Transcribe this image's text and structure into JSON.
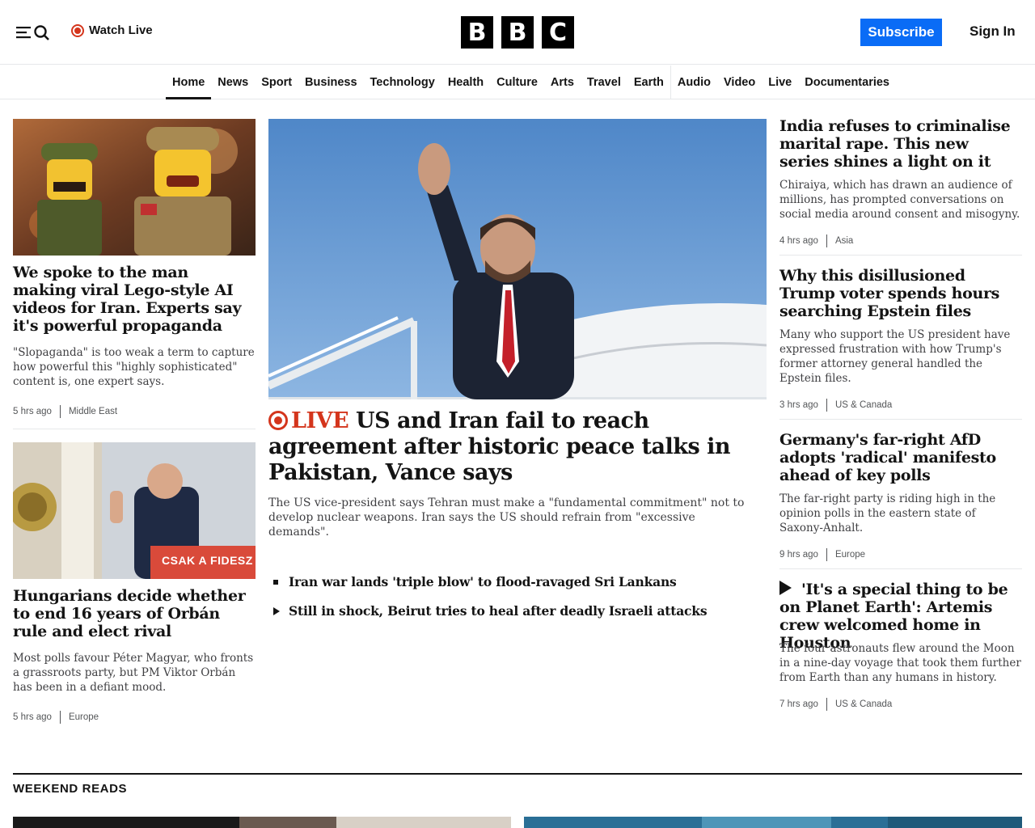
{
  "header": {
    "watch_live": "Watch Live",
    "logo_letters": [
      "B",
      "B",
      "C"
    ],
    "subscribe": "Subscribe",
    "sign_in": "Sign In"
  },
  "nav": {
    "items": [
      "Home",
      "News",
      "Sport",
      "Business",
      "Technology",
      "Health",
      "Culture",
      "Arts",
      "Travel",
      "Earth",
      "Audio",
      "Video",
      "Live",
      "Documentaries"
    ],
    "active": "Home"
  },
  "left": [
    {
      "headline": "We spoke to the man making viral Lego-style AI videos for Iran. Experts say it's powerful propaganda",
      "summary": "\"Slopaganda\" is too weak a term to capture how powerful this \"highly sophisticated\" content is, one expert says.",
      "time": "5 hrs ago",
      "section": "Middle East"
    },
    {
      "headline": "Hungarians decide whether to end 16 years of Orbán rule and elect rival",
      "summary": "Most polls favour Péter Magyar, who fronts a grassroots party, but PM Viktor Orbán has been in a defiant mood.",
      "time": "5 hrs ago",
      "section": "Europe",
      "image_caption": "CSAK A FIDESZ"
    }
  ],
  "main": {
    "live_label": "LIVE",
    "headline": " US and Iran fail to reach agreement after historic peace talks in Pakistan, Vance says",
    "summary": "The US vice-president says Tehran must make a \"fundamental commitment\" not to develop nuclear weapons. Iran says the US should refrain from \"excessive demands\".",
    "related": [
      {
        "text": "Iran war lands 'triple blow' to flood-ravaged Sri Lankans",
        "kind": "article"
      },
      {
        "text": "Still in shock, Beirut tries to heal after deadly Israeli attacks",
        "kind": "video"
      }
    ]
  },
  "right": [
    {
      "headline": "India refuses to criminalise marital rape. This new series shines a light on it",
      "summary": "Chiraiya, which has drawn an audience of millions, has prompted conversations on social media around consent and misogyny.",
      "time": "4 hrs ago",
      "section": "Asia"
    },
    {
      "headline": "Why this disillusioned Trump voter spends hours searching Epstein files",
      "summary": "Many who support the US president have expressed frustration with how Trump's former attorney general handled the Epstein files.",
      "time": "3 hrs ago",
      "section": "US & Canada"
    },
    {
      "headline": "Germany's far-right AfD adopts 'radical' manifesto ahead of key polls",
      "summary": "The far-right party is riding high in the opinion polls in the eastern state of Saxony-Anhalt.",
      "time": "9 hrs ago",
      "section": "Europe"
    },
    {
      "headline": "'It's a special thing to be on Planet Earth': Artemis crew welcomed home in Houston",
      "summary": "The four astronauts flew around the Moon in a nine-day voyage that took them further from Earth than any humans in history.",
      "time": "7 hrs ago",
      "section": "US & Canada"
    }
  ],
  "weekend": {
    "title": "WEEKEND READS"
  },
  "colors": {
    "live_red": "#d4351c",
    "subscribe_blue": "#0a6cf6",
    "text": "#141414"
  }
}
